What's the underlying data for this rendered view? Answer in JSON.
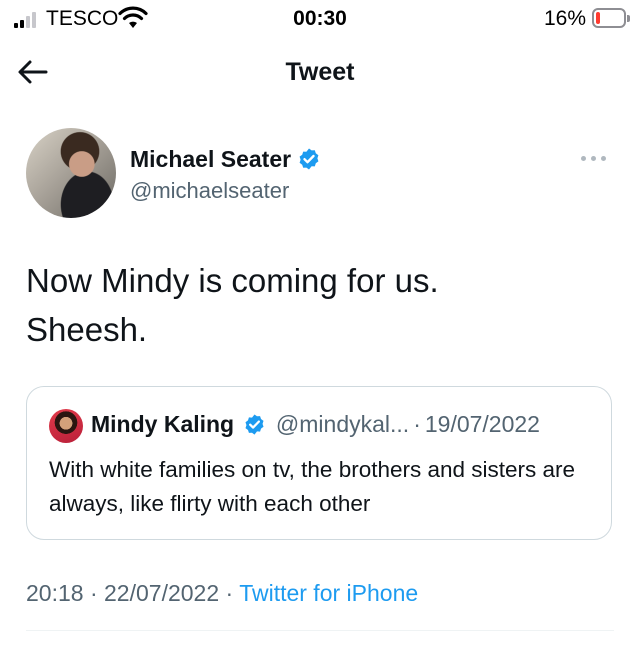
{
  "status_bar": {
    "carrier": "TESCO",
    "time": "00:30",
    "battery_percent": "16%",
    "battery_level": 0.16,
    "signal_bars_active": 2,
    "signal_bars_total": 4
  },
  "header": {
    "title": "Tweet",
    "back_icon": "arrow-left-icon"
  },
  "tweet": {
    "author": {
      "display_name": "Michael Seater",
      "handle": "@michaelseater",
      "verified": true
    },
    "text_line1": "Now Mindy is coming for us.",
    "text_line2": "Sheesh.",
    "quoted": {
      "display_name": "Mindy Kaling",
      "handle": "@mindykal...",
      "separator": "·",
      "date": "19/07/2022",
      "verified": true,
      "text": "With white families on tv, the brothers and sisters are always, like flirty with each other"
    },
    "meta": {
      "time": "20:18",
      "separator": "·",
      "date": "22/07/2022",
      "source": "Twitter for iPhone"
    }
  },
  "colors": {
    "accent": "#1d9bf0",
    "secondary_text": "#536471",
    "primary_text": "#0f1419",
    "border": "#cfd9de",
    "battery_low": "#ff3b30"
  }
}
